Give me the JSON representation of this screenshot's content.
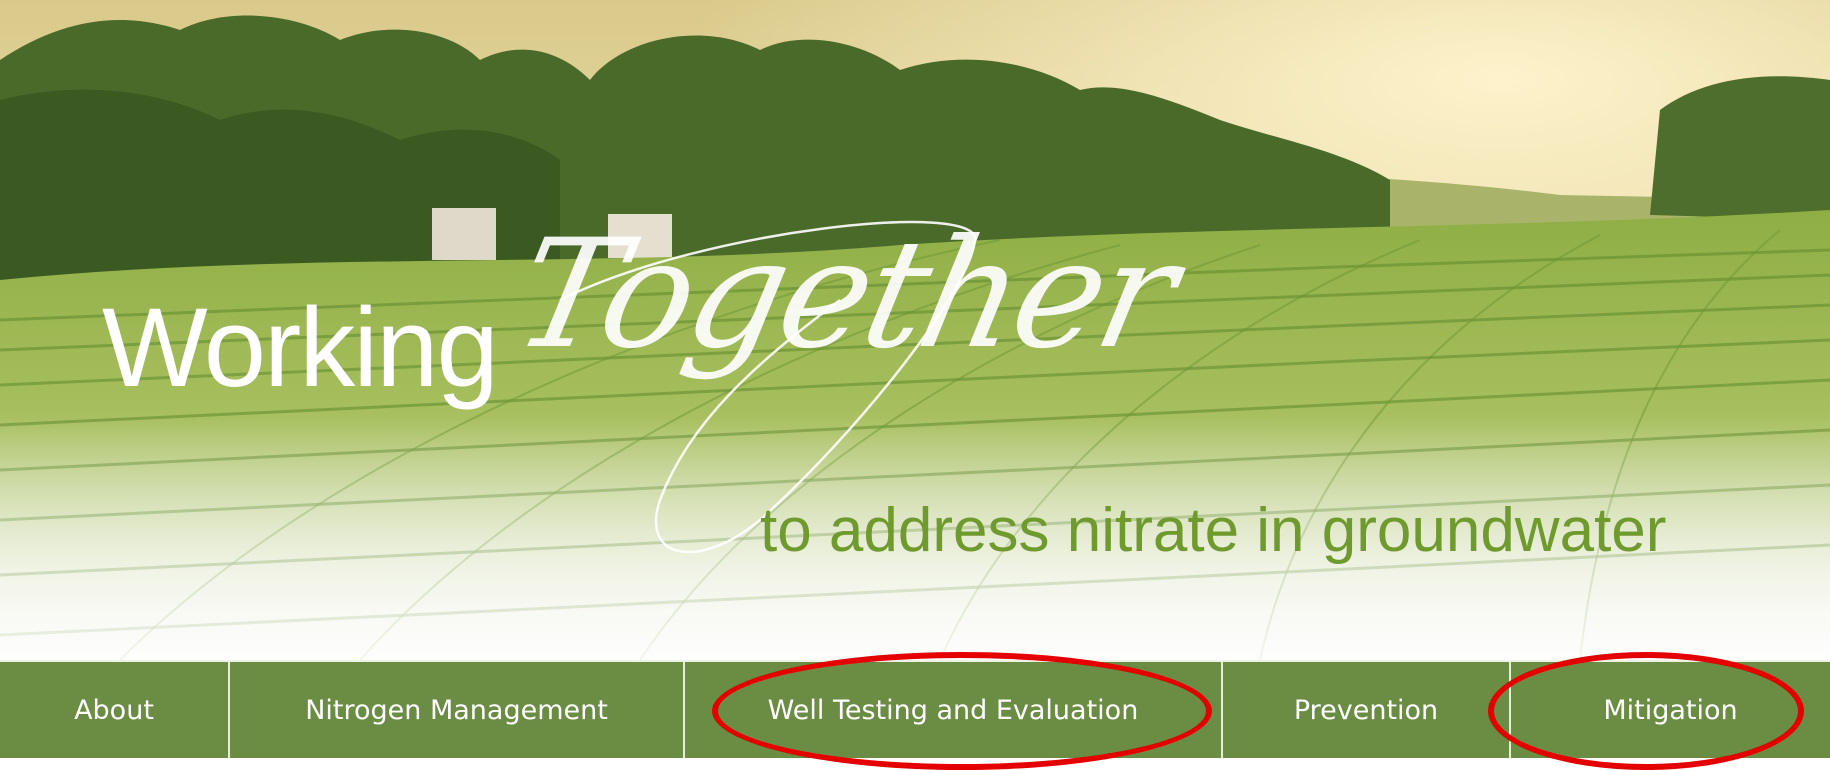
{
  "hero": {
    "headline_word": "Working",
    "script_word": "Together",
    "subline": "to address nitrate in groundwater"
  },
  "nav": {
    "items": [
      {
        "label": "About"
      },
      {
        "label": "Nitrogen Management"
      },
      {
        "label": "Well Testing and Evaluation"
      },
      {
        "label": "Prevention"
      },
      {
        "label": "Mitigation"
      }
    ]
  },
  "colors": {
    "nav_bg": "#6a8c43",
    "subline_green": "#6f9a2e",
    "annotation_red": "#e40000"
  }
}
